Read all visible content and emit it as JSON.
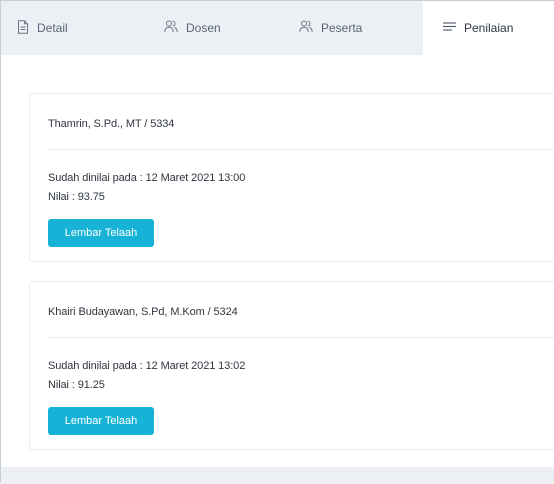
{
  "tabs": [
    {
      "label": "Detail",
      "icon": "document-icon",
      "active": false
    },
    {
      "label": "Dosen",
      "icon": "users-icon",
      "active": false
    },
    {
      "label": "Peserta",
      "icon": "users-icon",
      "active": false
    },
    {
      "label": "Penilaian",
      "icon": "lines-icon",
      "active": true
    }
  ],
  "cards": [
    {
      "header": "Thamrin, S.Pd., MT / 5334",
      "date_line": "Sudah dinilai pada : 12 Maret 2021 13:00",
      "nilai_line": "Nilai : 93.75",
      "button_label": "Lembar Telaah"
    },
    {
      "header": "Khairi Budayawan, S.Pd, M.Kom / 5324",
      "date_line": "Sudah dinilai pada : 12 Maret 2021 13:02",
      "nilai_line": "Nilai : 91.25",
      "button_label": "Lembar Telaah"
    }
  ],
  "colors": {
    "accent": "#17b3d6",
    "tabbar_bg": "#ecf0f4",
    "text": "#2f3640",
    "muted_text": "#5a6678"
  }
}
